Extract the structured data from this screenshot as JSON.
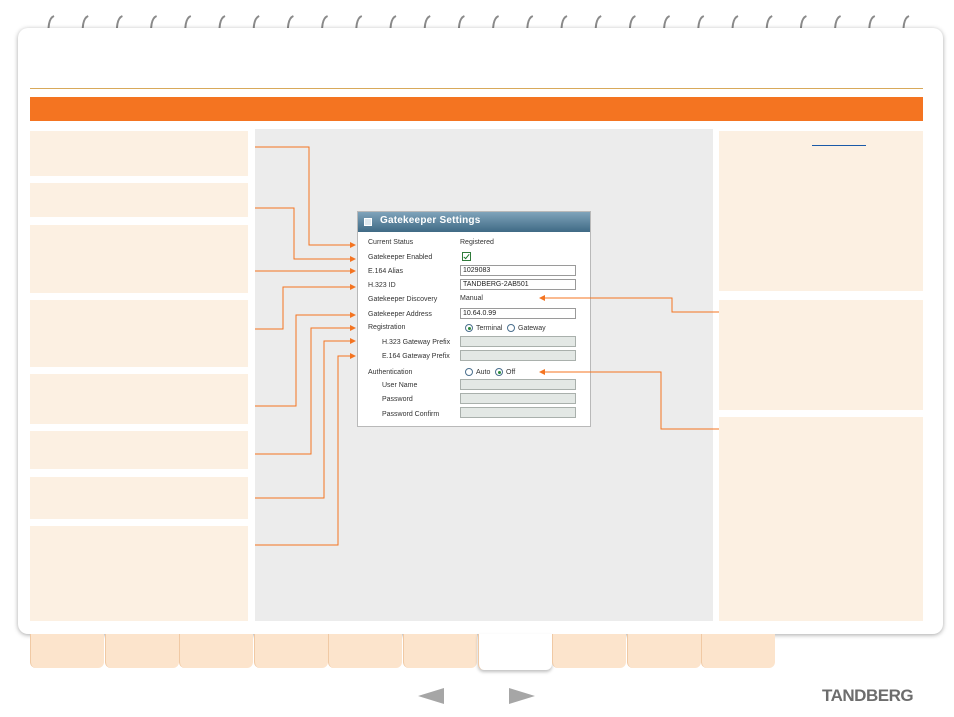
{
  "gatekeeper_panel": {
    "title": "Gatekeeper Settings",
    "rows": {
      "current_status": {
        "label": "Current Status",
        "value": "Registered"
      },
      "gatekeeper_enabled": {
        "label": "Gatekeeper Enabled",
        "checked": true
      },
      "e164_alias": {
        "label": "E.164 Alias",
        "value": "1029083"
      },
      "h323_id": {
        "label": "H.323 ID",
        "value": "TANDBERG-2AB501"
      },
      "gatekeeper_discovery": {
        "label": "Gatekeeper Discovery",
        "value": "Manual"
      },
      "gatekeeper_address": {
        "label": "Gatekeeper Address",
        "value": "10.64.0.99"
      },
      "registration": {
        "label": "Registration",
        "options": [
          "Terminal",
          "Gateway"
        ],
        "selected": "Terminal"
      },
      "h323_gateway_prefix": {
        "label": "H.323 Gateway Prefix",
        "value": ""
      },
      "e164_gateway_prefix": {
        "label": "E.164 Gateway Prefix",
        "value": ""
      },
      "authentication": {
        "label": "Authentication",
        "options": [
          "Auto",
          "Off"
        ],
        "selected": "Off"
      },
      "user_name": {
        "label": "User Name",
        "value": ""
      },
      "password": {
        "label": "Password",
        "value": ""
      },
      "password_confirm": {
        "label": "Password Confirm",
        "value": ""
      }
    }
  },
  "footer": {
    "logo": "TANDBERG",
    "active_tab_index": 6,
    "tab_count": 10
  },
  "colors": {
    "accent_orange": "#f47421",
    "box_fill": "#fcf0e2",
    "tab_fill": "#fce4cc",
    "panel_title": "#4f7891"
  }
}
